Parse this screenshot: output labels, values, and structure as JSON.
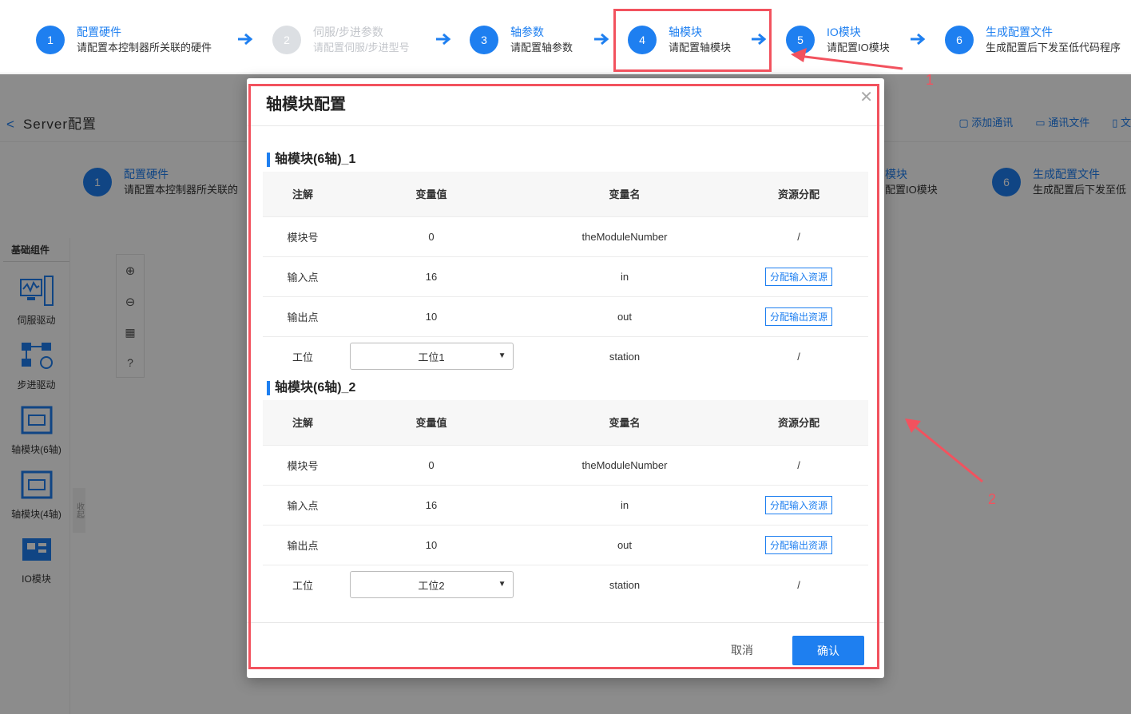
{
  "stepper": [
    {
      "num": "1",
      "title": "配置硬件",
      "desc": "请配置本控制器所关联的硬件",
      "disabled": false
    },
    {
      "num": "2",
      "title": "伺服/步进参数",
      "desc": "请配置伺服/步进型号",
      "disabled": true
    },
    {
      "num": "3",
      "title": "轴参数",
      "desc": "请配置轴参数",
      "disabled": false
    },
    {
      "num": "4",
      "title": "轴模块",
      "desc": "请配置轴模块",
      "disabled": false
    },
    {
      "num": "5",
      "title": "IO模块",
      "desc": "请配置IO模块",
      "disabled": false
    },
    {
      "num": "6",
      "title": "生成配置文件",
      "desc": "生成配置后下发至低代码程序",
      "disabled": false
    }
  ],
  "background": {
    "page_title": "Server配置",
    "actions": [
      "添加通讯",
      "通讯文件",
      "文"
    ],
    "step1": {
      "num": "1",
      "title": "配置硬件",
      "desc": "请配置本控制器所关联的"
    },
    "step5": {
      "title": "模块",
      "desc": "配置IO模块"
    },
    "step6": {
      "num": "6",
      "title": "生成配置文件",
      "desc": "生成配置后下发至低"
    },
    "sidebar_header": "基础组件",
    "components": [
      "伺服驱动",
      "步进驱动",
      "轴模块(6轴)",
      "轴模块(4轴)",
      "IO模块"
    ],
    "collapse_label": "收起"
  },
  "modal": {
    "title": "轴模块配置",
    "columns": [
      "注解",
      "变量值",
      "变量名",
      "资源分配"
    ],
    "sections": [
      {
        "title": "轴模块(6轴)_1",
        "rows": [
          {
            "note": "模块号",
            "value": "0",
            "name": "theModuleNumber",
            "resource": "/"
          },
          {
            "note": "输入点",
            "value": "16",
            "name": "in",
            "resource": "分配输入资源"
          },
          {
            "note": "输出点",
            "value": "10",
            "name": "out",
            "resource": "分配输出资源"
          },
          {
            "note": "工位",
            "value": "工位1",
            "name": "station",
            "resource": "/"
          }
        ]
      },
      {
        "title": "轴模块(6轴)_2",
        "rows": [
          {
            "note": "模块号",
            "value": "0",
            "name": "theModuleNumber",
            "resource": "/"
          },
          {
            "note": "输入点",
            "value": "16",
            "name": "in",
            "resource": "分配输入资源"
          },
          {
            "note": "输出点",
            "value": "10",
            "name": "out",
            "resource": "分配输出资源"
          },
          {
            "note": "工位",
            "value": "工位2",
            "name": "station",
            "resource": "/"
          }
        ]
      }
    ],
    "cancel_label": "取消",
    "ok_label": "确认"
  },
  "annotations": {
    "label1": "1",
    "label2": "2",
    "color": "#f2525e"
  },
  "colors": {
    "primary": "#1e7ff0",
    "disabled": "#dcdfe3"
  }
}
